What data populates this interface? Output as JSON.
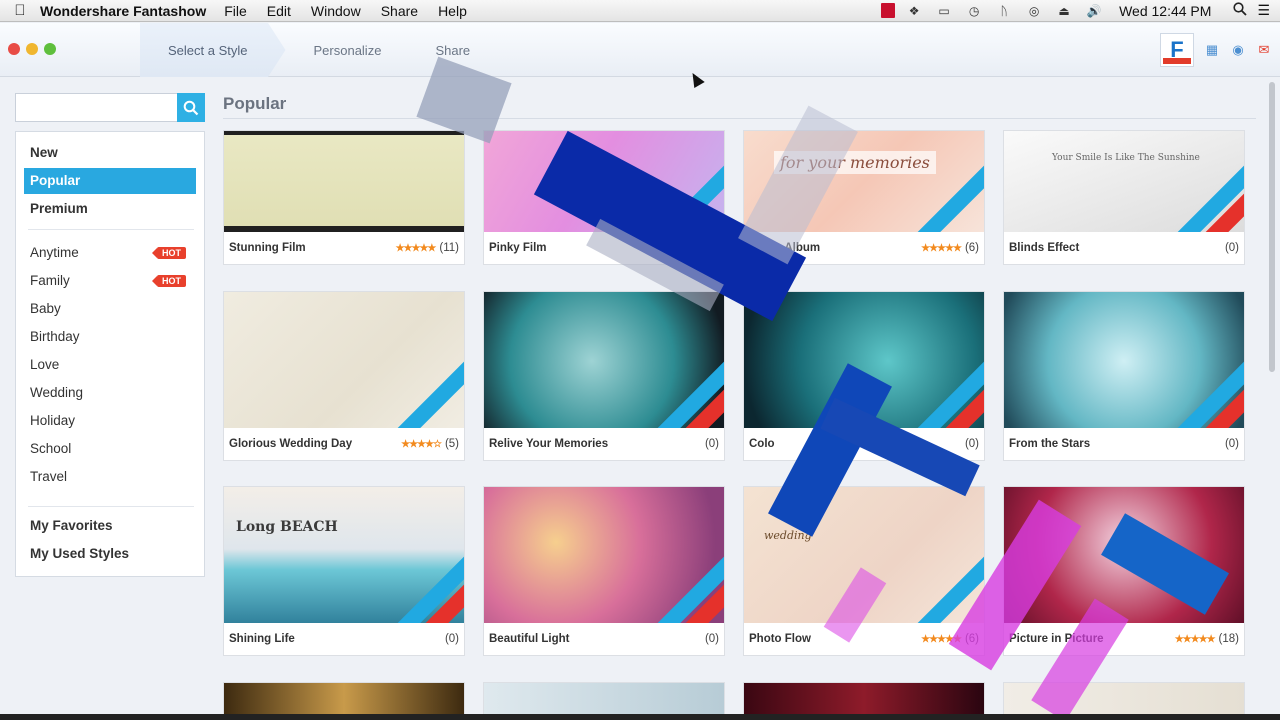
{
  "menubar": {
    "app_name": "Wondershare Fantashow",
    "items": [
      "File",
      "Edit",
      "Window",
      "Share",
      "Help"
    ],
    "clock": "Wed 12:44 PM"
  },
  "toolbar": {
    "steps": [
      "Select a Style",
      "Personalize",
      "Share"
    ],
    "active_step": 0,
    "logo_letter": "F"
  },
  "search": {
    "placeholder": "",
    "value": ""
  },
  "sidebar": {
    "top_items": [
      "New",
      "Popular",
      "Premium"
    ],
    "active": "Popular",
    "categories": [
      {
        "label": "Anytime",
        "badge": "HOT"
      },
      {
        "label": "Family",
        "badge": "HOT"
      },
      {
        "label": "Baby"
      },
      {
        "label": "Birthday"
      },
      {
        "label": "Love"
      },
      {
        "label": "Wedding"
      },
      {
        "label": "Holiday"
      },
      {
        "label": "School"
      },
      {
        "label": "Travel"
      }
    ],
    "bottom_items": [
      "My Favorites",
      "My Used Styles"
    ]
  },
  "main": {
    "title": "Popular",
    "cards": [
      {
        "title": "Stunning Film",
        "rating": 4.5,
        "count": "(11)",
        "premium": false,
        "new": false,
        "thumb_text": ""
      },
      {
        "title": "Pinky Film",
        "rating": 0,
        "count": "",
        "premium": true,
        "new": false,
        "thumb_text": ""
      },
      {
        "title": "Photo Album",
        "rating": 4.5,
        "count": "(6)",
        "premium": true,
        "new": false,
        "thumb_text": "for your memories"
      },
      {
        "title": "Blinds Effect",
        "rating": 0,
        "count": "(0)",
        "premium": true,
        "new": true,
        "thumb_text": "Your Smile Is Like The Sunshine"
      },
      {
        "title": "Glorious Wedding Day",
        "rating": 3.5,
        "count": "(5)",
        "premium": true,
        "new": false,
        "thumb_text": ""
      },
      {
        "title": "Relive Your Memories",
        "rating": 0,
        "count": "(0)",
        "premium": true,
        "new": true,
        "thumb_text": ""
      },
      {
        "title": "Colo",
        "rating": 0,
        "count": "(0)",
        "premium": true,
        "new": true,
        "thumb_text": ""
      },
      {
        "title": "From the Stars",
        "rating": 0,
        "count": "(0)",
        "premium": true,
        "new": true,
        "thumb_text": ""
      },
      {
        "title": "Shining Life",
        "rating": 0,
        "count": "(0)",
        "premium": true,
        "new": true,
        "thumb_text": "Long BEACH"
      },
      {
        "title": "Beautiful Light",
        "rating": 0,
        "count": "(0)",
        "premium": true,
        "new": true,
        "thumb_text": ""
      },
      {
        "title": "Photo Flow",
        "rating": 4.5,
        "count": "(6)",
        "premium": true,
        "new": false,
        "thumb_text": "wedding"
      },
      {
        "title": "Picture in Picture",
        "rating": 4.5,
        "count": "(18)",
        "premium": false,
        "new": false,
        "thumb_text": ""
      }
    ]
  },
  "colors": {
    "accent": "#29a8e0",
    "premium_ribbon": "#21a9e1",
    "new_ribbon": "#e5312b",
    "hot_badge": "#e8402c",
    "star": "#f28a1e"
  }
}
